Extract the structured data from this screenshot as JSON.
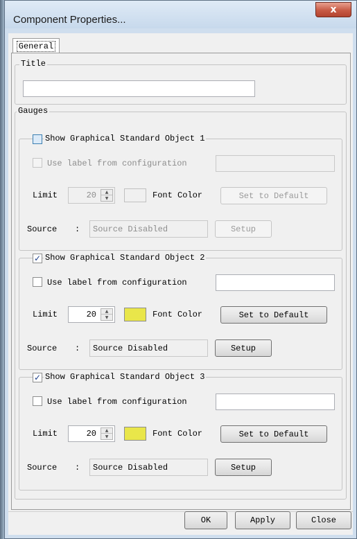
{
  "window": {
    "title": "Component Properties...",
    "close_glyph": "x"
  },
  "tabs": [
    {
      "label": "General",
      "selected": true
    }
  ],
  "title_group": {
    "legend": "Title",
    "value": ""
  },
  "gauges": {
    "legend": "Gauges",
    "objects": [
      {
        "label": "Show Graphical Standard Object 1",
        "checked": false,
        "enabled": false,
        "use_label_text": "Use label from configuration",
        "use_label_checked": false,
        "label_value": "",
        "limit_label": "Limit",
        "limit_value": "20",
        "font_color_label": "Font Color",
        "font_color": "#f0f0f0",
        "set_default_label": "Set to Default",
        "source_label": "Source",
        "source_sep": ":",
        "source_value": "Source Disabled",
        "setup_label": "Setup"
      },
      {
        "label": "Show Graphical Standard Object 2",
        "checked": true,
        "enabled": true,
        "use_label_text": "Use label from configuration",
        "use_label_checked": false,
        "label_value": "",
        "limit_label": "Limit",
        "limit_value": "20",
        "font_color_label": "Font Color",
        "font_color": "#e9e64a",
        "set_default_label": "Set to Default",
        "source_label": "Source",
        "source_sep": ":",
        "source_value": "Source Disabled",
        "setup_label": "Setup"
      },
      {
        "label": "Show Graphical Standard Object 3",
        "checked": true,
        "enabled": true,
        "use_label_text": "Use label from configuration",
        "use_label_checked": false,
        "label_value": "",
        "limit_label": "Limit",
        "limit_value": "20",
        "font_color_label": "Font Color",
        "font_color": "#e9e64a",
        "set_default_label": "Set to Default",
        "source_label": "Source",
        "source_sep": ":",
        "source_value": "Source Disabled",
        "setup_label": "Setup"
      }
    ]
  },
  "footer": {
    "ok_label": "OK",
    "apply_label": "Apply",
    "close_label": "Close"
  },
  "colors": {
    "title_bar": "#cfdeee",
    "close_button": "#c75a45",
    "swatch_yellow": "#e9e64a"
  },
  "icons": {
    "close": "close-icon",
    "check": "checkmark-icon",
    "spin_up": "spin-up-icon",
    "spin_down": "spin-down-icon"
  }
}
